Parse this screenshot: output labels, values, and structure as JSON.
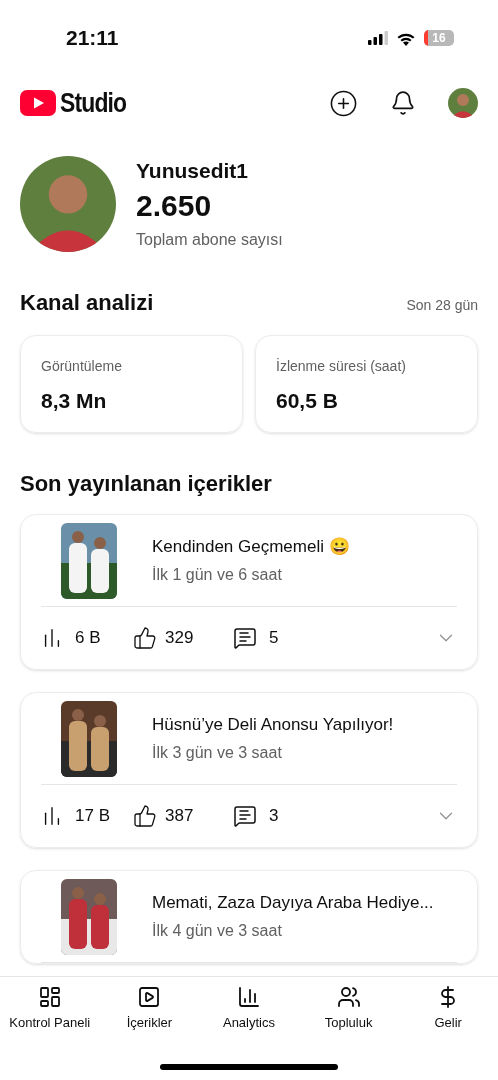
{
  "status_bar": {
    "time": "21:11",
    "battery": "16"
  },
  "header": {
    "logo": "Studio"
  },
  "channel": {
    "name": "Yunusedit1",
    "subscribers": "2.650",
    "subscribers_label": "Toplam abone sayısı"
  },
  "analytics": {
    "title": "Kanal analizi",
    "period": "Son 28 gün",
    "cards": [
      {
        "label": "Görüntüleme",
        "value": "8,3 Mn"
      },
      {
        "label": "İzlenme süresi (saat)",
        "value": "60,5 B"
      }
    ]
  },
  "recent": {
    "title": "Son yayınlanan içerikler",
    "items": [
      {
        "title": "Kendinden Geçmemeli 😀",
        "age": "İlk 1 gün ve 6 saat",
        "views": "6 B",
        "likes": "329",
        "comments": "5"
      },
      {
        "title": "Hüsnü’ye Deli Anonsu Yapılıyor!",
        "age": "İlk 3 gün ve 3 saat",
        "views": "17 B",
        "likes": "387",
        "comments": "3"
      },
      {
        "title": "Memati, Zaza Dayıya Araba Hediye...",
        "age": "İlk 4 gün ve 3 saat"
      }
    ]
  },
  "nav": [
    {
      "label": "Kontrol Paneli",
      "kind": "dashboard"
    },
    {
      "label": "İçerikler",
      "kind": "content"
    },
    {
      "label": "Analytics",
      "kind": "analytics"
    },
    {
      "label": "Topluluk",
      "kind": "community"
    },
    {
      "label": "Gelir",
      "kind": "earn"
    }
  ]
}
